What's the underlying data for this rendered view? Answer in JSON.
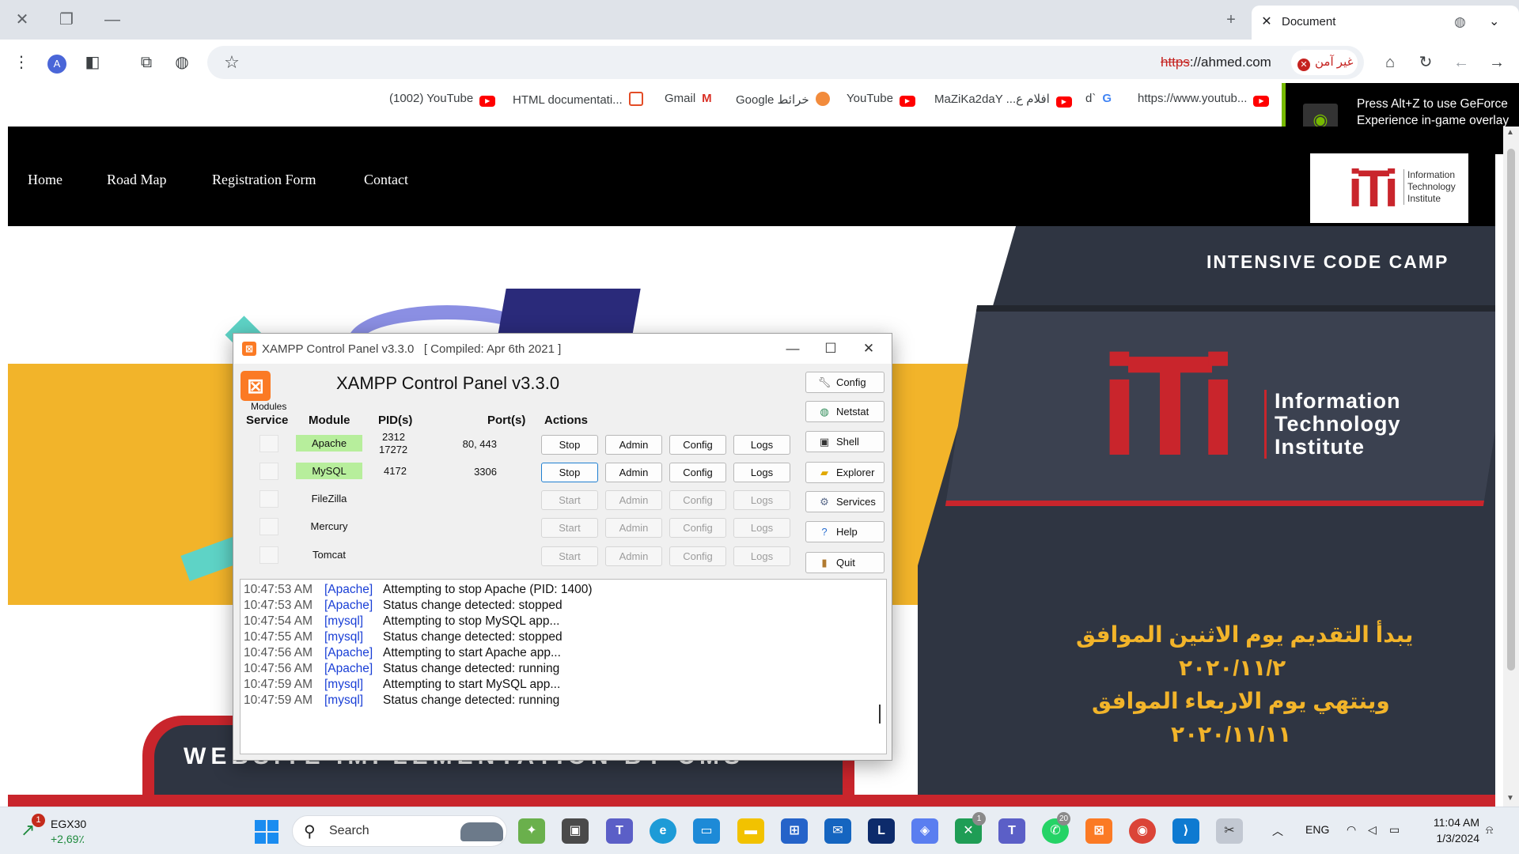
{
  "browser": {
    "tab_title": "Document",
    "url_scheme": "https",
    "url_rest": "://ahmed.com",
    "security_label": "غير آمن",
    "bookmarks": [
      "(1002) YouTube",
      "HTML documentati...",
      "Gmail",
      "Google خرائط",
      "YouTube",
      "MaZiKa2daY ...افلام ع",
      "d`",
      "https://www.youtub..."
    ],
    "profile_initial": "A"
  },
  "overlay": {
    "text": "Press Alt+Z to use GeForce Experience in-game overlay"
  },
  "site": {
    "nav": [
      "Home",
      "Road Map",
      "Registration Form",
      "Contact"
    ],
    "brand_lines": [
      "Information",
      "Technology",
      "Institute"
    ],
    "camp": "INTENSIVE CODE CAMP",
    "iti_lines": [
      "Information",
      "Technology",
      "Institute"
    ],
    "arabic": [
      "يبدأ التقديم يوم الاثنين الموافق",
      "٢٠٢٠/١١/٢",
      "وينتهي يوم الاربعاء الموافق",
      "٢٠٢٠/١١/١١"
    ],
    "banner_text": "WEBSITE IMPLEMENTATION BY CMS"
  },
  "xampp": {
    "title": "XAMPP Control Panel v3.3.0   [ Compiled: Apr 6th 2021 ]",
    "heading": "XAMPP Control Panel v3.3.0",
    "modules_label": "Modules",
    "headers": {
      "service": "Service",
      "module": "Module",
      "pid": "PID(s)",
      "port": "Port(s)",
      "actions": "Actions"
    },
    "modules": [
      {
        "name": "Apache",
        "running": true,
        "pid1": "2312",
        "pid2": "17272",
        "port": "80, 443",
        "action": "Stop"
      },
      {
        "name": "MySQL",
        "running": true,
        "pid1": "4172",
        "pid2": "",
        "port": "3306",
        "action": "Stop"
      },
      {
        "name": "FileZilla",
        "running": false,
        "pid1": "",
        "pid2": "",
        "port": "",
        "action": "Start"
      },
      {
        "name": "Mercury",
        "running": false,
        "pid1": "",
        "pid2": "",
        "port": "",
        "action": "Start"
      },
      {
        "name": "Tomcat",
        "running": false,
        "pid1": "",
        "pid2": "",
        "port": "",
        "action": "Start"
      }
    ],
    "action_labels": {
      "admin": "Admin",
      "config": "Config",
      "logs": "Logs"
    },
    "side_buttons": [
      "Config",
      "Netstat",
      "Shell",
      "Explorer",
      "Services",
      "Help",
      "Quit"
    ],
    "log": [
      {
        "time": "10:47:53 AM",
        "module": "[Apache]",
        "msg": "Attempting to stop Apache (PID: 1400)"
      },
      {
        "time": "10:47:53 AM",
        "module": "[Apache]",
        "msg": "Status change detected: stopped"
      },
      {
        "time": "10:47:54 AM",
        "module": "[mysql]",
        "msg": "Attempting to stop MySQL app..."
      },
      {
        "time": "10:47:55 AM",
        "module": "[mysql]",
        "msg": "Status change detected: stopped"
      },
      {
        "time": "10:47:56 AM",
        "module": "[Apache]",
        "msg": "Attempting to start Apache app..."
      },
      {
        "time": "10:47:56 AM",
        "module": "[Apache]",
        "msg": "Status change detected: running"
      },
      {
        "time": "10:47:59 AM",
        "module": "[mysql]",
        "msg": "Attempting to start MySQL app..."
      },
      {
        "time": "10:47:59 AM",
        "module": "[mysql]",
        "msg": "Status change detected: running"
      }
    ]
  },
  "taskbar": {
    "widget_name": "EGX30",
    "widget_value": "+2,69٪",
    "widget_badge": "1",
    "search_placeholder": "Search",
    "badge_a": "1",
    "badge_b": "20",
    "lang": "ENG",
    "time": "11:04 AM",
    "date": "1/3/2024"
  },
  "colors": {
    "accent_red": "#c9252c",
    "accent_yellow": "#f2b42a",
    "nvidia_green": "#76b900",
    "xampp_orange": "#fb7a24",
    "running_green": "#b7ee9c"
  }
}
